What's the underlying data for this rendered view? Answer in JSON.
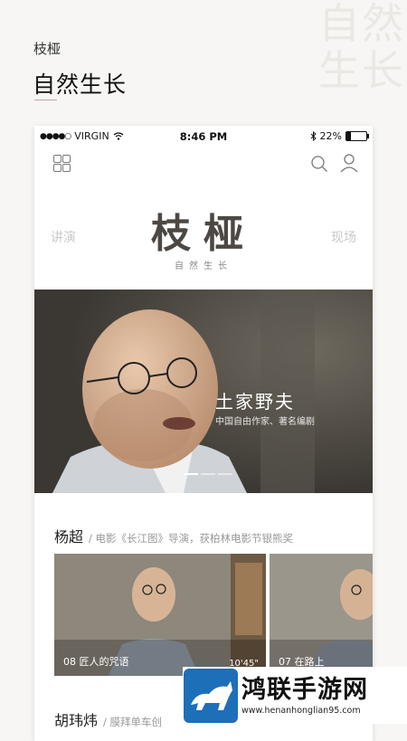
{
  "promo": {
    "app_name": "枝桠",
    "tagline": "自然生长",
    "bg_text": "自然生长"
  },
  "status_bar": {
    "carrier": "VIRGIN",
    "time": "8:46 PM",
    "battery": "22%",
    "battery_level": 0.22
  },
  "header": {
    "logo": "枝桠",
    "logo_sub": "自然生长",
    "tab_left": "讲演",
    "tab_right": "现场"
  },
  "hero": {
    "title": "土家野夫",
    "subtitle": "中国自由作家、著名编剧",
    "page_count": 3,
    "active_page": 0
  },
  "sections": [
    {
      "name": "杨超",
      "desc": "/ 电影《长江图》导演，获柏林电影节银熊奖",
      "videos": [
        {
          "title": "08 匠人的咒语",
          "duration": "10'45\""
        },
        {
          "title": "07 在路上",
          "duration": ""
        }
      ]
    },
    {
      "name": "胡玮炜",
      "desc": "/ 膜拜单车创"
    }
  ],
  "watermark": {
    "name": "鸿联手游网",
    "url": "www.henanhonglian95.com"
  },
  "colors": {
    "accent_line": "#c9a29a",
    "logo": "#4d4843",
    "watermark_blue": "#1d6fb8"
  }
}
